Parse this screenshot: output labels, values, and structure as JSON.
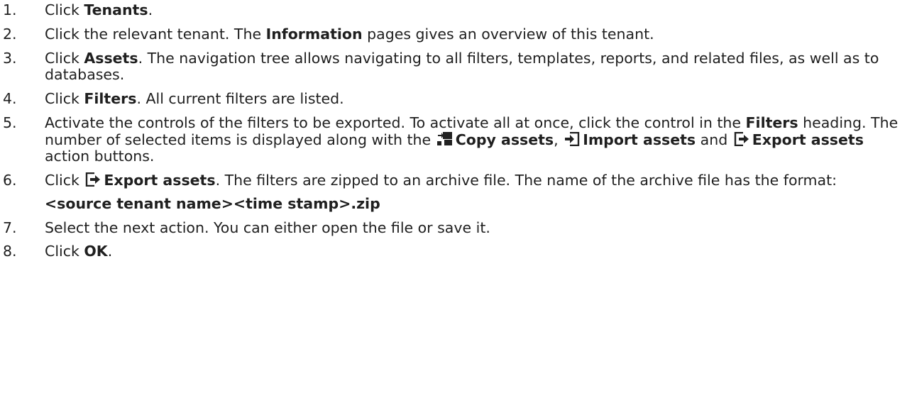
{
  "steps": [
    {
      "num": "1.",
      "parts": [
        "Click ",
        "Tenants",
        "."
      ]
    },
    {
      "num": "2.",
      "parts": [
        "Click the relevant tenant. The ",
        "Information",
        " pages gives an overview of this tenant."
      ]
    },
    {
      "num": "3.",
      "parts": [
        "Click ",
        "Assets",
        ". The navigation tree allows navigating to all filters, templates, reports, and related files, as well as to databases."
      ]
    },
    {
      "num": "4.",
      "parts": [
        "Click ",
        "Filters",
        ". All current filters are listed."
      ]
    },
    {
      "num": "5.",
      "parts": [
        "Activate the controls of the filters to be exported. To activate all at once, click the control in the ",
        "Filters",
        " heading. The number of selected items is displayed along with the ",
        "Copy assets",
        ", ",
        "Import assets",
        " and ",
        "Export assets",
        " action buttons."
      ]
    },
    {
      "num": "6.",
      "parts": [
        "Click ",
        "Export assets",
        ". The filters are zipped to an archive file. The name of the archive file has the format:"
      ],
      "code": "<source tenant name><time stamp>.zip"
    },
    {
      "num": "7.",
      "parts": [
        "Select the next action. You can either open the file or save it."
      ]
    },
    {
      "num": "8.",
      "parts": [
        "Click ",
        "OK",
        "."
      ]
    }
  ],
  "icons": {
    "copy": "copy-assets-icon",
    "import": "import-assets-icon",
    "export": "export-assets-icon"
  },
  "colors": {
    "text": "#1f1f1f",
    "icon": "#222222"
  }
}
